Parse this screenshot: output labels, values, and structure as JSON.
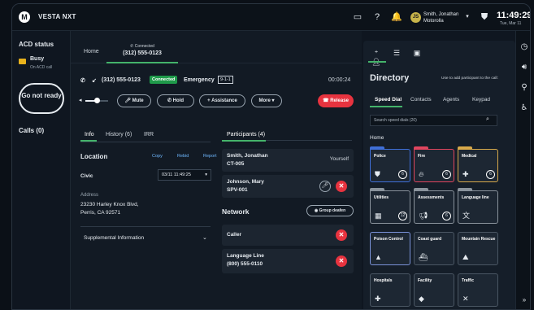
{
  "topbar": {
    "app_name": "VESTA NXT",
    "avatar_initials": "JS",
    "user_name": "Smith, Jonathan",
    "user_location": "Motorolla",
    "time": "11:49:29",
    "date": "Tue, Mar 11"
  },
  "acd": {
    "title": "ACD status",
    "status": "Busy",
    "status_sub": "On ACD call",
    "not_ready": "Go not ready",
    "calls": "Calls (0)"
  },
  "main": {
    "home_tab": "Home",
    "conn_tab_label": "Connected",
    "conn_tab_number": "(312) 555-0123",
    "call_number": "(312) 555-0123",
    "connected_badge": "Connected",
    "call_type": "Emergency",
    "nine_one_one": "9-1-1",
    "timer": "00:00:24",
    "volume_level": 0.5,
    "controls": {
      "mute": "Mute",
      "hold": "Hold",
      "assistance": "Assistance",
      "more": "More",
      "release": "Release"
    },
    "tabs": {
      "info": "Info",
      "history": "History (6)",
      "irr": "IRR",
      "participants": "Participants (4)"
    },
    "location": {
      "title": "Location",
      "copy": "Copy",
      "rebid": "Rebid",
      "report": "Report",
      "civic": "Civic",
      "datetime": "03/11 11:49:25",
      "address_label": "Address",
      "address_line1": "23230 Harley Knox Blvd,",
      "address_line2": "Perris, CA 92571",
      "supplemental": "Supplemental Information"
    },
    "participants": [
      {
        "name": "Smith, Jonathan",
        "id": "CT-005",
        "tag": "Yourself"
      },
      {
        "name": "Johnson, Mary",
        "id": "SPV-001"
      }
    ],
    "network": {
      "title": "Network",
      "deafen": "Group deafen",
      "items": [
        {
          "name": "Caller"
        },
        {
          "name": "Language Line",
          "sub": "(800) 555-0110"
        }
      ]
    }
  },
  "directory": {
    "title": "Directory",
    "hint": "Use to add participant to the call:",
    "tabs": {
      "speed_dial": "Speed Dial",
      "contacts": "Contacts",
      "agents": "Agents",
      "keypad": "Keypad"
    },
    "search_placeholder": "Search speed dials (20)",
    "home_label": "Home",
    "tiles": [
      {
        "title": "Police",
        "count": "6",
        "color": "#3f6fd8"
      },
      {
        "title": "Fire",
        "count": "6",
        "color": "#e0455e"
      },
      {
        "title": "Medical",
        "count": "6",
        "color": "#d8a94a"
      },
      {
        "title": "Utilities",
        "count": "12",
        "color": "#8a939c"
      },
      {
        "title": "Assessments",
        "count": "6",
        "color": "#8a939c"
      },
      {
        "title": "Language line",
        "count": "",
        "color": "#8a939c"
      },
      {
        "title": "Poison Control",
        "count": "",
        "color": "#7a92d8"
      },
      {
        "title": "Coast guard",
        "count": "",
        "color": "#4a5663"
      },
      {
        "title": "Mountain Rescue",
        "count": "",
        "color": "#4a5663"
      },
      {
        "title": "Hospitals",
        "count": "",
        "color": "#4a5663"
      },
      {
        "title": "Facility",
        "count": "",
        "color": "#4a5663"
      },
      {
        "title": "Traffic",
        "count": "",
        "color": "#4a5663"
      }
    ]
  }
}
